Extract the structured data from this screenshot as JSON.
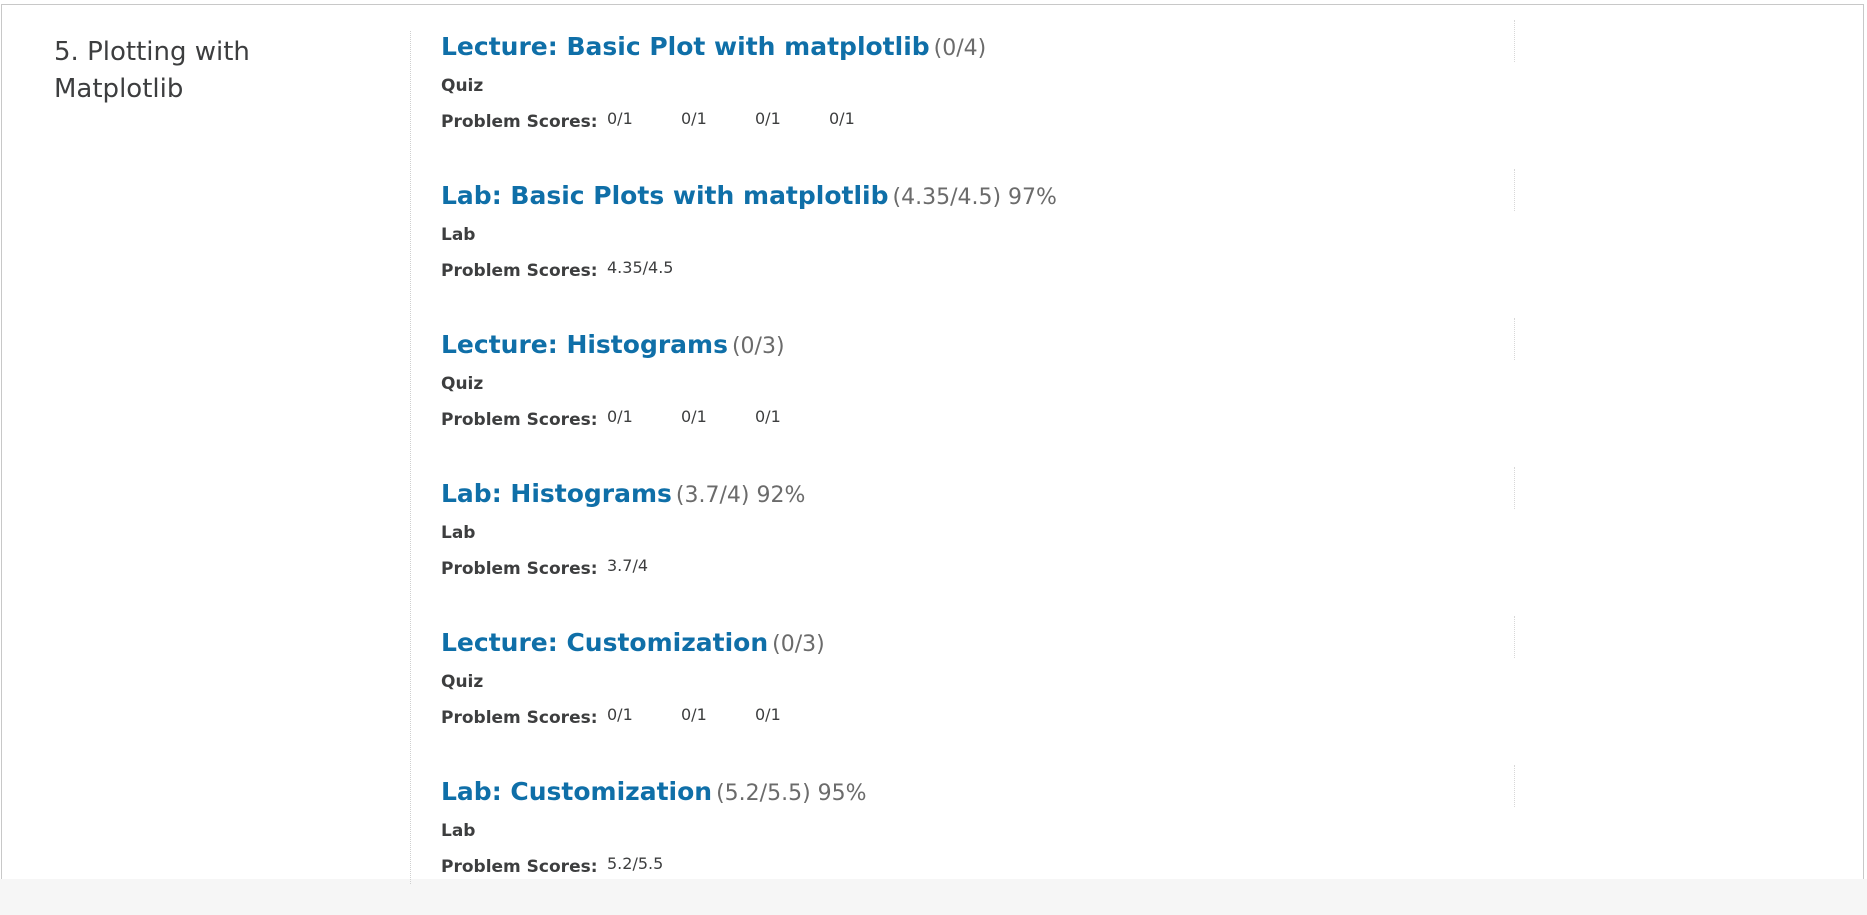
{
  "chapter": {
    "title": "5. Plotting with Matplotlib"
  },
  "scores_label": "Problem Scores:",
  "sections": [
    {
      "title": "Lecture: Basic Plot with matplotlib",
      "score": "(0/4)",
      "type": "Quiz",
      "problem_scores": [
        "0/1",
        "0/1",
        "0/1",
        "0/1"
      ]
    },
    {
      "title": "Lab: Basic Plots with matplotlib",
      "score": "(4.35/4.5) 97%",
      "type": "Lab",
      "problem_scores": [
        "4.35/4.5"
      ]
    },
    {
      "title": "Lecture: Histograms",
      "score": "(0/3)",
      "type": "Quiz",
      "problem_scores": [
        "0/1",
        "0/1",
        "0/1"
      ]
    },
    {
      "title": "Lab: Histograms",
      "score": "(3.7/4) 92%",
      "type": "Lab",
      "problem_scores": [
        "3.7/4"
      ]
    },
    {
      "title": "Lecture: Customization",
      "score": "(0/3)",
      "type": "Quiz",
      "problem_scores": [
        "0/1",
        "0/1",
        "0/1"
      ]
    },
    {
      "title": "Lab: Customization",
      "score": "(5.2/5.5) 95%",
      "type": "Lab",
      "problem_scores": [
        "5.2/5.5"
      ]
    }
  ],
  "colors": {
    "link": "#0f6fa8",
    "text": "#3d3e3f",
    "muted": "#6b6b6b"
  }
}
